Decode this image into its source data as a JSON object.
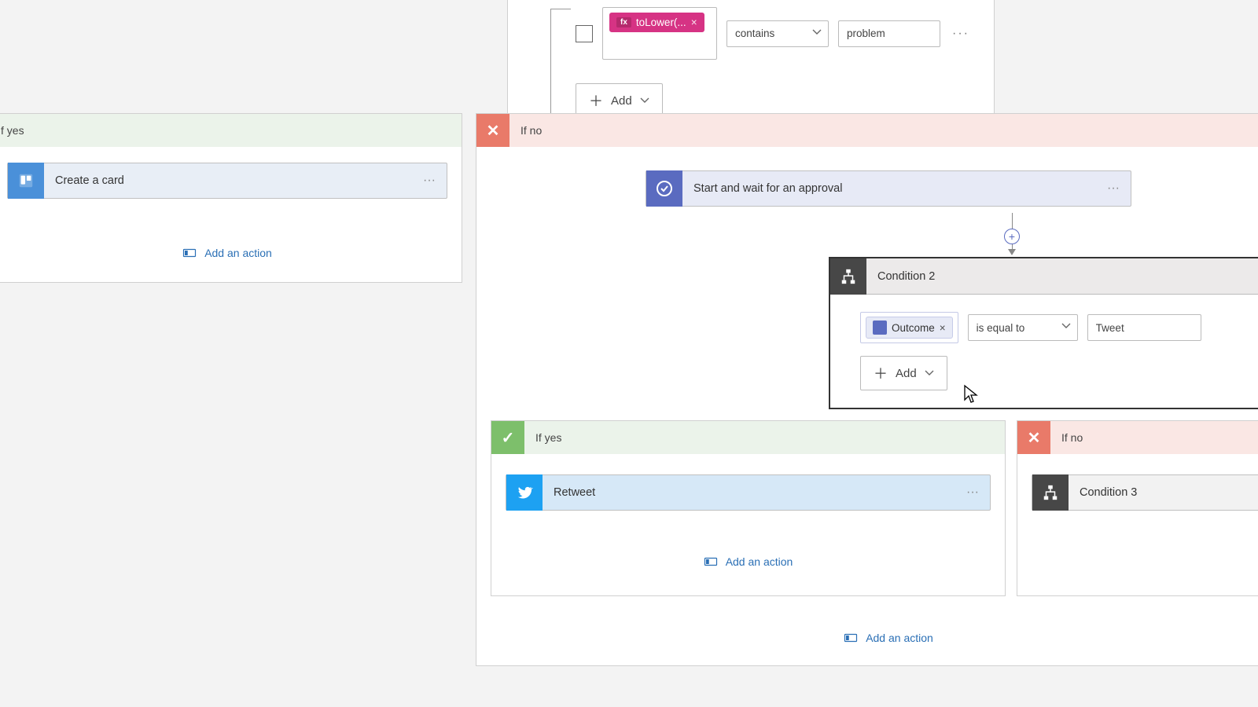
{
  "top_condition": {
    "token_fx": "toLower(...",
    "operator": "contains",
    "value": "problem",
    "add": "Add"
  },
  "left_branch": {
    "label": "f yes",
    "card_title": "Create a card",
    "add_action": "Add an action"
  },
  "right_branch": {
    "label": "If no",
    "approval_title": "Start and wait for an approval",
    "cond2_title": "Condition 2",
    "cond2": {
      "token": "Outcome",
      "operator": "is equal to",
      "value": "Tweet",
      "add": "Add"
    },
    "nested_yes": {
      "label": "If yes",
      "card_title": "Retweet",
      "add_action": "Add an action"
    },
    "nested_no": {
      "label": "If no",
      "card_title": "Condition 3"
    },
    "bottom_add_action": "Add an action"
  },
  "chart_data": {
    "type": "table",
    "note": "Not a chart; flow designer UI."
  }
}
